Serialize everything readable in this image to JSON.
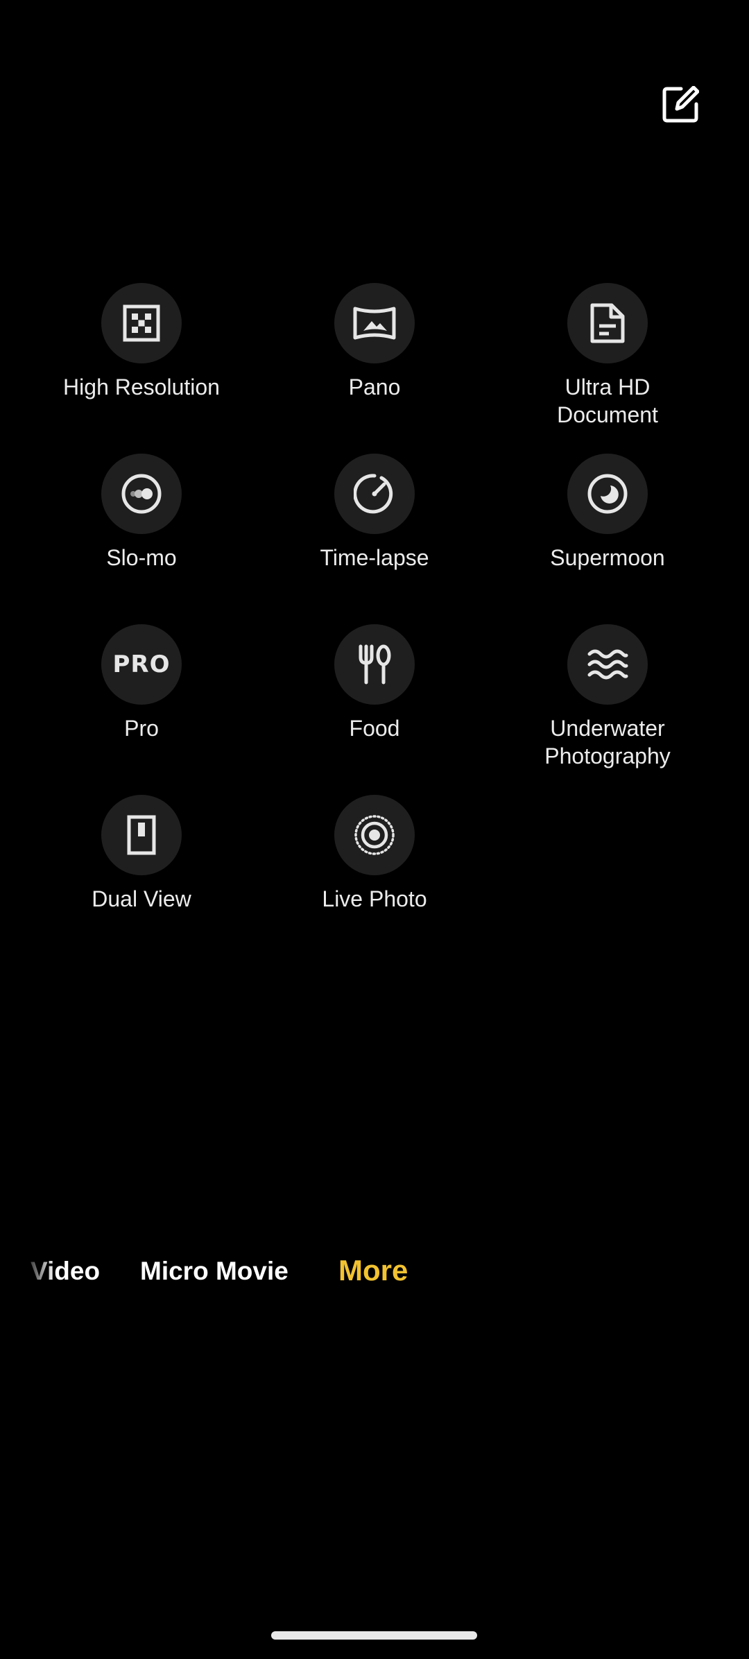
{
  "header": {
    "edit_icon": "edit-icon"
  },
  "modes": [
    {
      "label": "High Resolution",
      "icon": "high-resolution-icon"
    },
    {
      "label": "Pano",
      "icon": "pano-icon"
    },
    {
      "label": "Ultra HD\nDocument",
      "icon": "document-icon"
    },
    {
      "label": "Slo-mo",
      "icon": "slo-mo-icon"
    },
    {
      "label": "Time-lapse",
      "icon": "time-lapse-icon"
    },
    {
      "label": "Supermoon",
      "icon": "moon-icon"
    },
    {
      "label": "Pro",
      "icon": "pro-icon",
      "icon_text": "PRO"
    },
    {
      "label": "Food",
      "icon": "food-icon"
    },
    {
      "label": "Underwater\nPhotography",
      "icon": "waves-icon"
    },
    {
      "label": "Dual View",
      "icon": "dual-view-icon"
    },
    {
      "label": "Live Photo",
      "icon": "live-photo-icon"
    }
  ],
  "tabs": {
    "video": "Video",
    "micro_movie": "Micro Movie",
    "more": "More"
  },
  "colors": {
    "background": "#000000",
    "icon_circle": "#1f1f1f",
    "accent": "#f2c230",
    "text": "#ececec"
  }
}
